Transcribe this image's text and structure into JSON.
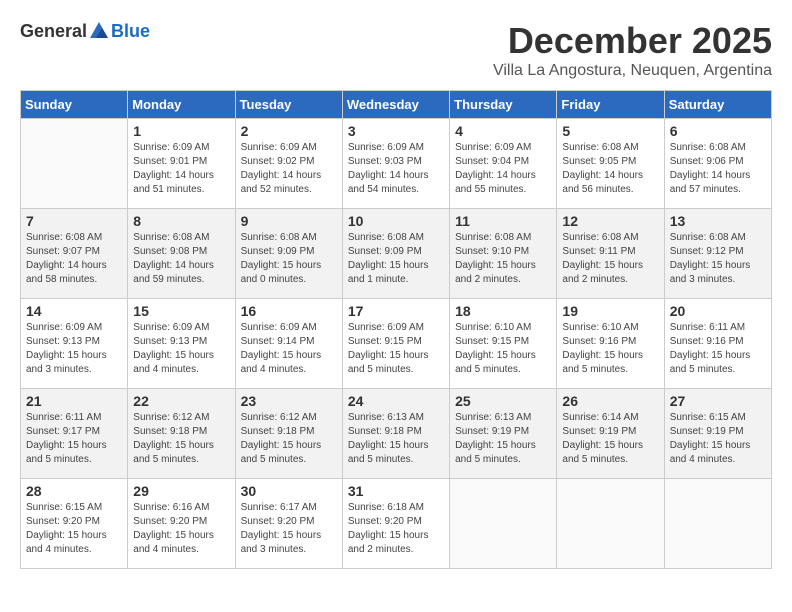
{
  "logo": {
    "general": "General",
    "blue": "Blue"
  },
  "title": "December 2025",
  "subtitle": "Villa La Angostura, Neuquen, Argentina",
  "days_of_week": [
    "Sunday",
    "Monday",
    "Tuesday",
    "Wednesday",
    "Thursday",
    "Friday",
    "Saturday"
  ],
  "weeks": [
    [
      {
        "day": "",
        "info": ""
      },
      {
        "day": "1",
        "info": "Sunrise: 6:09 AM\nSunset: 9:01 PM\nDaylight: 14 hours\nand 51 minutes."
      },
      {
        "day": "2",
        "info": "Sunrise: 6:09 AM\nSunset: 9:02 PM\nDaylight: 14 hours\nand 52 minutes."
      },
      {
        "day": "3",
        "info": "Sunrise: 6:09 AM\nSunset: 9:03 PM\nDaylight: 14 hours\nand 54 minutes."
      },
      {
        "day": "4",
        "info": "Sunrise: 6:09 AM\nSunset: 9:04 PM\nDaylight: 14 hours\nand 55 minutes."
      },
      {
        "day": "5",
        "info": "Sunrise: 6:08 AM\nSunset: 9:05 PM\nDaylight: 14 hours\nand 56 minutes."
      },
      {
        "day": "6",
        "info": "Sunrise: 6:08 AM\nSunset: 9:06 PM\nDaylight: 14 hours\nand 57 minutes."
      }
    ],
    [
      {
        "day": "7",
        "info": "Sunrise: 6:08 AM\nSunset: 9:07 PM\nDaylight: 14 hours\nand 58 minutes."
      },
      {
        "day": "8",
        "info": "Sunrise: 6:08 AM\nSunset: 9:08 PM\nDaylight: 14 hours\nand 59 minutes."
      },
      {
        "day": "9",
        "info": "Sunrise: 6:08 AM\nSunset: 9:09 PM\nDaylight: 15 hours\nand 0 minutes."
      },
      {
        "day": "10",
        "info": "Sunrise: 6:08 AM\nSunset: 9:09 PM\nDaylight: 15 hours\nand 1 minute."
      },
      {
        "day": "11",
        "info": "Sunrise: 6:08 AM\nSunset: 9:10 PM\nDaylight: 15 hours\nand 2 minutes."
      },
      {
        "day": "12",
        "info": "Sunrise: 6:08 AM\nSunset: 9:11 PM\nDaylight: 15 hours\nand 2 minutes."
      },
      {
        "day": "13",
        "info": "Sunrise: 6:08 AM\nSunset: 9:12 PM\nDaylight: 15 hours\nand 3 minutes."
      }
    ],
    [
      {
        "day": "14",
        "info": "Sunrise: 6:09 AM\nSunset: 9:13 PM\nDaylight: 15 hours\nand 3 minutes."
      },
      {
        "day": "15",
        "info": "Sunrise: 6:09 AM\nSunset: 9:13 PM\nDaylight: 15 hours\nand 4 minutes."
      },
      {
        "day": "16",
        "info": "Sunrise: 6:09 AM\nSunset: 9:14 PM\nDaylight: 15 hours\nand 4 minutes."
      },
      {
        "day": "17",
        "info": "Sunrise: 6:09 AM\nSunset: 9:15 PM\nDaylight: 15 hours\nand 5 minutes."
      },
      {
        "day": "18",
        "info": "Sunrise: 6:10 AM\nSunset: 9:15 PM\nDaylight: 15 hours\nand 5 minutes."
      },
      {
        "day": "19",
        "info": "Sunrise: 6:10 AM\nSunset: 9:16 PM\nDaylight: 15 hours\nand 5 minutes."
      },
      {
        "day": "20",
        "info": "Sunrise: 6:11 AM\nSunset: 9:16 PM\nDaylight: 15 hours\nand 5 minutes."
      }
    ],
    [
      {
        "day": "21",
        "info": "Sunrise: 6:11 AM\nSunset: 9:17 PM\nDaylight: 15 hours\nand 5 minutes."
      },
      {
        "day": "22",
        "info": "Sunrise: 6:12 AM\nSunset: 9:18 PM\nDaylight: 15 hours\nand 5 minutes."
      },
      {
        "day": "23",
        "info": "Sunrise: 6:12 AM\nSunset: 9:18 PM\nDaylight: 15 hours\nand 5 minutes."
      },
      {
        "day": "24",
        "info": "Sunrise: 6:13 AM\nSunset: 9:18 PM\nDaylight: 15 hours\nand 5 minutes."
      },
      {
        "day": "25",
        "info": "Sunrise: 6:13 AM\nSunset: 9:19 PM\nDaylight: 15 hours\nand 5 minutes."
      },
      {
        "day": "26",
        "info": "Sunrise: 6:14 AM\nSunset: 9:19 PM\nDaylight: 15 hours\nand 5 minutes."
      },
      {
        "day": "27",
        "info": "Sunrise: 6:15 AM\nSunset: 9:19 PM\nDaylight: 15 hours\nand 4 minutes."
      }
    ],
    [
      {
        "day": "28",
        "info": "Sunrise: 6:15 AM\nSunset: 9:20 PM\nDaylight: 15 hours\nand 4 minutes."
      },
      {
        "day": "29",
        "info": "Sunrise: 6:16 AM\nSunset: 9:20 PM\nDaylight: 15 hours\nand 4 minutes."
      },
      {
        "day": "30",
        "info": "Sunrise: 6:17 AM\nSunset: 9:20 PM\nDaylight: 15 hours\nand 3 minutes."
      },
      {
        "day": "31",
        "info": "Sunrise: 6:18 AM\nSunset: 9:20 PM\nDaylight: 15 hours\nand 2 minutes."
      },
      {
        "day": "",
        "info": ""
      },
      {
        "day": "",
        "info": ""
      },
      {
        "day": "",
        "info": ""
      }
    ]
  ]
}
